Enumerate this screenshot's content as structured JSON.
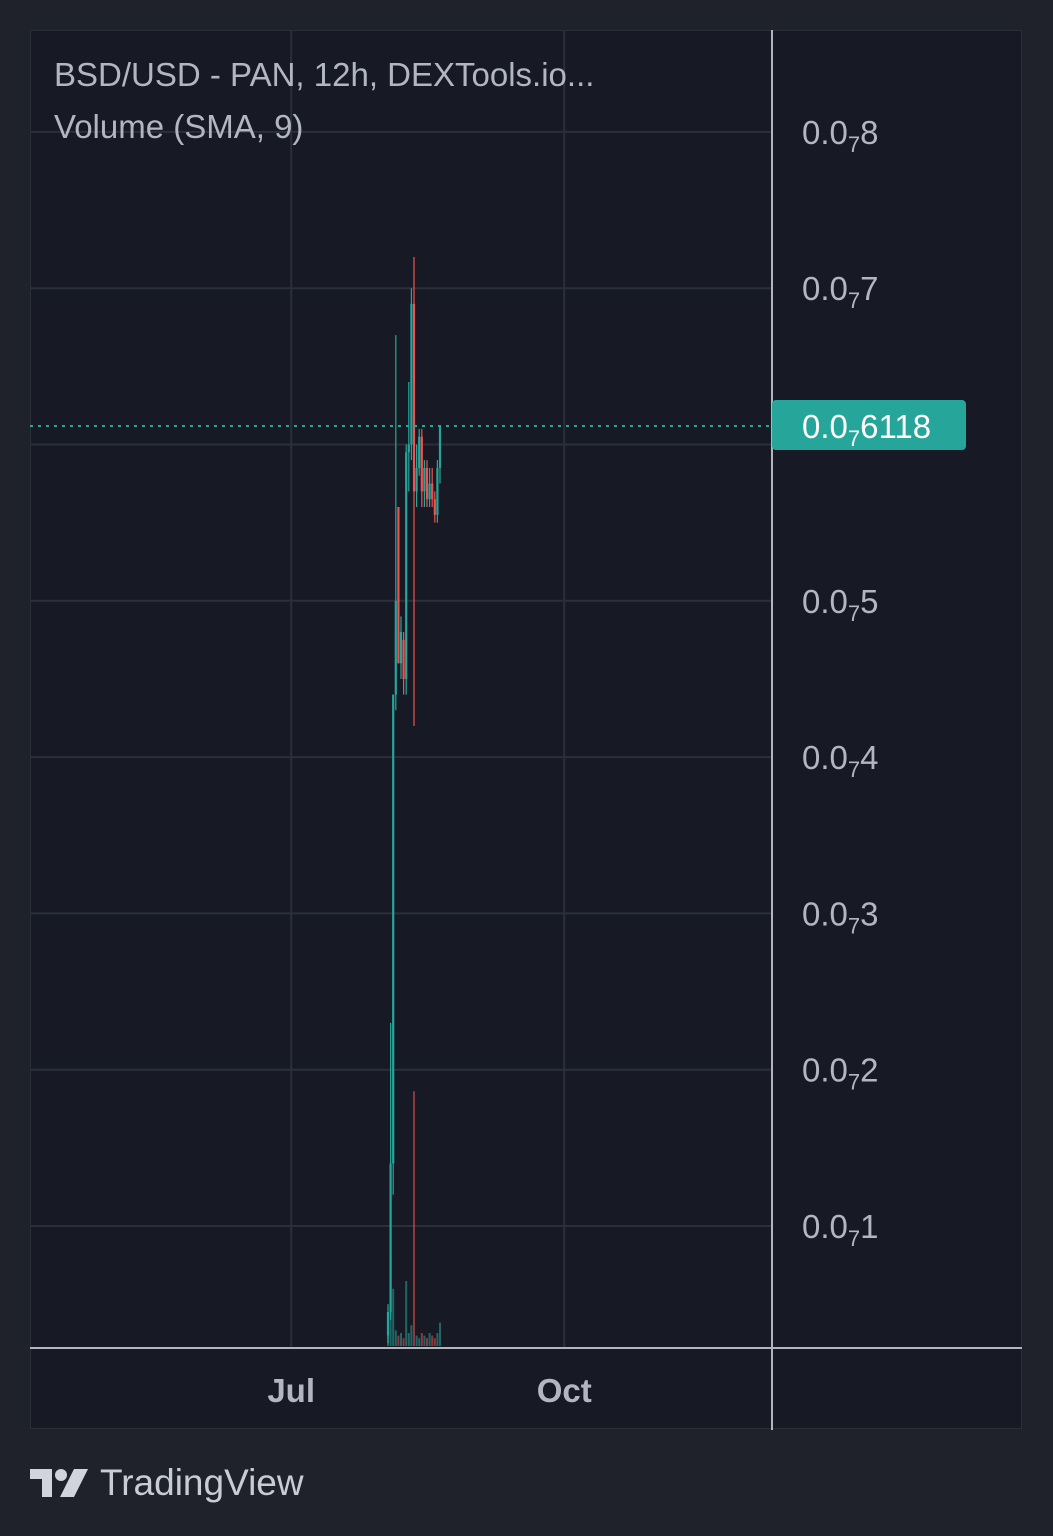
{
  "legend": {
    "title": "BSD/USD - PAN, 12h, DEXTools.io...",
    "volume_label": "Volume (SMA, 9)"
  },
  "footer": {
    "brand": "TradingView",
    "logo_icon": "tradingview-logo-icon"
  },
  "colors": {
    "background": "#171a25",
    "outer": "#1f222b",
    "grid": "#2b2f3a",
    "axis_line": "#b2b5be",
    "up": "#26a69a",
    "down": "#ef5350",
    "label_text": "#b3b6bf",
    "price_tag_bg": "#26a69a",
    "price_tag_text": "#ffffff"
  },
  "chart_data": {
    "type": "candlestick",
    "symbol": "BSD/USD",
    "exchange": "PAN",
    "interval": "12h",
    "y_tick_labels": [
      {
        "value": 0.8,
        "prefix": "0.0",
        "sub": "7",
        "suffix": "8"
      },
      {
        "value": 0.7,
        "prefix": "0.0",
        "sub": "7",
        "suffix": "7"
      },
      {
        "value": 0.5,
        "prefix": "0.0",
        "sub": "7",
        "suffix": "5"
      },
      {
        "value": 0.4,
        "prefix": "0.0",
        "sub": "7",
        "suffix": "4"
      },
      {
        "value": 0.3,
        "prefix": "0.0",
        "sub": "7",
        "suffix": "3"
      },
      {
        "value": 0.2,
        "prefix": "0.0",
        "sub": "7",
        "suffix": "2"
      },
      {
        "value": 0.1,
        "prefix": "0.0",
        "sub": "7",
        "suffix": "1"
      }
    ],
    "y_gridlines": [
      0.8,
      0.7,
      0.6,
      0.5,
      0.4,
      0.3,
      0.2,
      0.1
    ],
    "ylim": [
      0.0,
      0.8
    ],
    "x_ticks": [
      {
        "label": "Jul",
        "pos": 88
      },
      {
        "label": "Oct",
        "pos": 180
      }
    ],
    "xlim": [
      0,
      250
    ],
    "last_price": {
      "value": 0.6118,
      "prefix": "0.0",
      "sub": "7",
      "suffix": "6118"
    },
    "candles": [
      {
        "t": 0,
        "o": 0.03,
        "h": 0.05,
        "l": 0.025,
        "c": 0.045
      },
      {
        "t": 1,
        "o": 0.045,
        "h": 0.23,
        "l": 0.04,
        "c": 0.14
      },
      {
        "t": 2,
        "o": 0.14,
        "h": 0.44,
        "l": 0.12,
        "c": 0.44
      },
      {
        "t": 3,
        "o": 0.44,
        "h": 0.67,
        "l": 0.43,
        "c": 0.5
      },
      {
        "t": 4,
        "o": 0.56,
        "h": 0.56,
        "l": 0.46,
        "c": 0.46
      },
      {
        "t": 5,
        "o": 0.46,
        "h": 0.49,
        "l": 0.45,
        "c": 0.48
      },
      {
        "t": 6,
        "o": 0.475,
        "h": 0.48,
        "l": 0.44,
        "c": 0.45
      },
      {
        "t": 7,
        "o": 0.45,
        "h": 0.6,
        "l": 0.44,
        "c": 0.595
      },
      {
        "t": 8,
        "o": 0.595,
        "h": 0.64,
        "l": 0.57,
        "c": 0.6
      },
      {
        "t": 9,
        "o": 0.6,
        "h": 0.7,
        "l": 0.59,
        "c": 0.69
      },
      {
        "t": 10,
        "o": 0.69,
        "h": 0.72,
        "l": 0.42,
        "c": 0.57
      },
      {
        "t": 11,
        "o": 0.57,
        "h": 0.6,
        "l": 0.56,
        "c": 0.585
      },
      {
        "t": 12,
        "o": 0.585,
        "h": 0.61,
        "l": 0.58,
        "c": 0.605
      },
      {
        "t": 13,
        "o": 0.605,
        "h": 0.61,
        "l": 0.56,
        "c": 0.57
      },
      {
        "t": 14,
        "o": 0.57,
        "h": 0.59,
        "l": 0.56,
        "c": 0.585
      },
      {
        "t": 15,
        "o": 0.585,
        "h": 0.59,
        "l": 0.56,
        "c": 0.565
      },
      {
        "t": 16,
        "o": 0.565,
        "h": 0.585,
        "l": 0.56,
        "c": 0.575
      },
      {
        "t": 17,
        "o": 0.575,
        "h": 0.585,
        "l": 0.56,
        "c": 0.565
      },
      {
        "t": 18,
        "o": 0.565,
        "h": 0.57,
        "l": 0.55,
        "c": 0.555
      },
      {
        "t": 19,
        "o": 0.555,
        "h": 0.59,
        "l": 0.55,
        "c": 0.585
      },
      {
        "t": 20,
        "o": 0.585,
        "h": 0.612,
        "l": 0.575,
        "c": 0.6118
      }
    ],
    "volume_ylim": [
      0,
      1.0
    ],
    "volume": [
      0.1,
      0.35,
      0.22,
      0.06,
      0.04,
      0.05,
      0.03,
      0.25,
      0.05,
      0.08,
      0.98,
      0.04,
      0.03,
      0.05,
      0.04,
      0.03,
      0.05,
      0.04,
      0.03,
      0.05,
      0.09
    ]
  }
}
